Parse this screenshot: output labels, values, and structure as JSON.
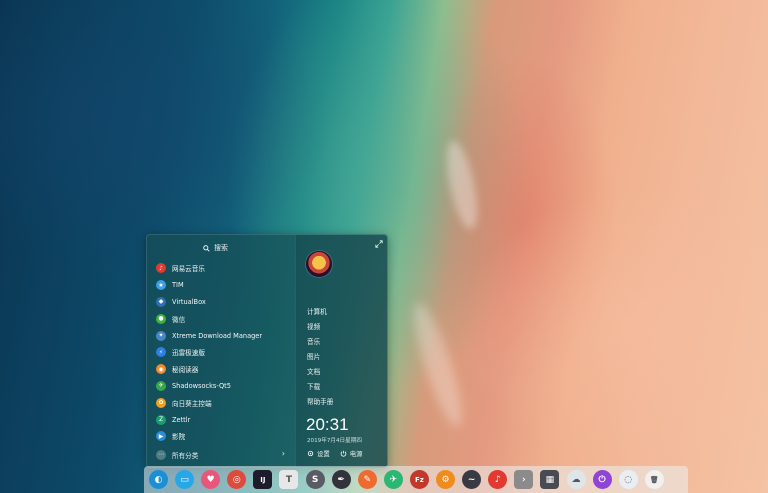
{
  "launcher": {
    "search_label": "搜索",
    "apps": [
      {
        "label": "网易云音乐",
        "icon": "netease-music-icon",
        "color": "#e03a31",
        "glyph": "♪"
      },
      {
        "label": "TIM",
        "icon": "tim-icon",
        "color": "#3b9ee8",
        "glyph": "★"
      },
      {
        "label": "VirtualBox",
        "icon": "virtualbox-icon",
        "color": "#2f6fb5",
        "glyph": "◆"
      },
      {
        "label": "微信",
        "icon": "wechat-icon",
        "color": "#3fb33f",
        "glyph": "●"
      },
      {
        "label": "Xtreme Download Manager",
        "icon": "xdm-icon",
        "color": "#4a86c5",
        "glyph": "✦"
      },
      {
        "label": "迅雷极速版",
        "icon": "thunder-icon",
        "color": "#2c7fe0",
        "glyph": "⚡"
      },
      {
        "label": "秘阅读器",
        "icon": "reader-icon",
        "color": "#f08a2c",
        "glyph": "◉"
      },
      {
        "label": "Shadowsocks-Qt5",
        "icon": "shadowsocks-icon",
        "color": "#37a84a",
        "glyph": "✈"
      },
      {
        "label": "向日葵主控端",
        "icon": "sunflower-icon",
        "color": "#f0a020",
        "glyph": "✿"
      },
      {
        "label": "Zettlr",
        "icon": "zettlr-icon",
        "color": "#1b9e6e",
        "glyph": "Z"
      },
      {
        "label": "影院",
        "icon": "cinema-icon",
        "color": "#2b8ed8",
        "glyph": "▶"
      }
    ],
    "all_categories_label": "所有分类",
    "directories": [
      "计算机",
      "视频",
      "音乐",
      "图片",
      "文档",
      "下载",
      "帮助手册"
    ],
    "clock": "20:31",
    "date": "2019年7月4日星期四",
    "settings_label": "设置",
    "power_label": "电源"
  },
  "dock": {
    "items": [
      {
        "name": "launcher-icon",
        "color": "#1a8fd6",
        "glyph": "◐"
      },
      {
        "name": "file-manager-icon",
        "color": "#27a7e6",
        "glyph": "▭"
      },
      {
        "name": "app-store-icon",
        "color": "#e8577a",
        "glyph": "♥"
      },
      {
        "name": "chrome-icon",
        "color": "#dd4b3c",
        "glyph": "◎"
      },
      {
        "name": "intellij-icon",
        "color": "#1c1c2c",
        "glyph": "IJ"
      },
      {
        "name": "typora-icon",
        "color": "#e7e7e7",
        "glyph": "T"
      },
      {
        "name": "scrivener-icon",
        "color": "#5b5b66",
        "glyph": "S"
      },
      {
        "name": "inkscape-icon",
        "color": "#33333b",
        "glyph": "✒"
      },
      {
        "name": "postman-icon",
        "color": "#ef6a2e",
        "glyph": "✎"
      },
      {
        "name": "shadowsocks-dock-icon",
        "color": "#2bb673",
        "glyph": "✈"
      },
      {
        "name": "filezilla-icon",
        "color": "#c0392b",
        "glyph": "Fz"
      },
      {
        "name": "settings-gear-icon",
        "color": "#f08c1d",
        "glyph": "⚙"
      },
      {
        "name": "gitkraken-icon",
        "color": "#3a3a44",
        "glyph": "~"
      },
      {
        "name": "netease-dock-icon",
        "color": "#e03a31",
        "glyph": "♪"
      },
      {
        "name": "terminal-icon",
        "color": "#8b8b8b",
        "glyph": "›"
      },
      {
        "name": "deepin-terminal-icon",
        "color": "#4a4a52",
        "glyph": "▦"
      },
      {
        "name": "weather-cloud-icon",
        "color": "#dfe6ea",
        "glyph": "☁"
      },
      {
        "name": "shutdown-icon",
        "color": "#8e44d6",
        "glyph": "⏻"
      },
      {
        "name": "baidu-netdisk-icon",
        "color": "#e9eef2",
        "glyph": "◌"
      },
      {
        "name": "trash-icon",
        "color": "#f0f0f0",
        "glyph": "🗑"
      }
    ]
  }
}
